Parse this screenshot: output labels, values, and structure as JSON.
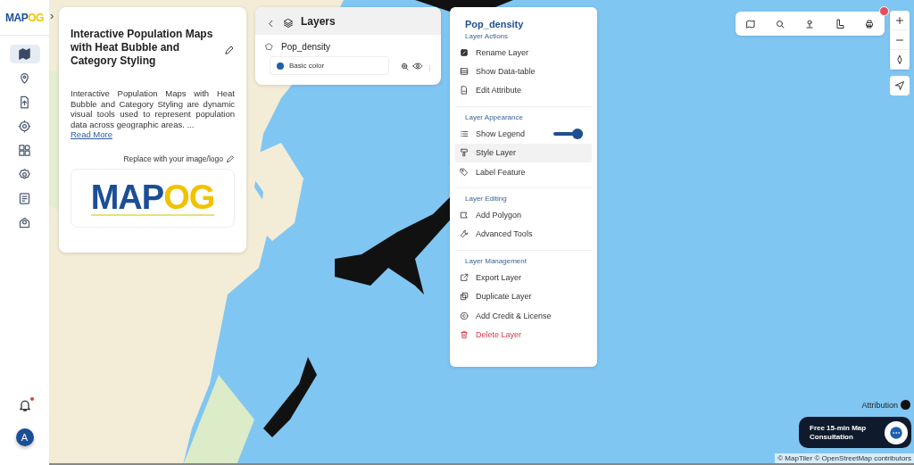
{
  "sidebar": {
    "logo": "MAPOG",
    "expand_glyph": "›",
    "nav_items": [
      {
        "kind": "map",
        "selected": true
      },
      {
        "kind": "pin",
        "selected": false
      },
      {
        "kind": "upload",
        "selected": false
      },
      {
        "kind": "gear",
        "selected": false
      },
      {
        "kind": "widgets",
        "selected": false
      },
      {
        "kind": "cog",
        "selected": false
      },
      {
        "kind": "report",
        "selected": false
      },
      {
        "kind": "share",
        "selected": false
      }
    ],
    "notifications_unread": true,
    "avatar": "A"
  },
  "info_card": {
    "title": "Interactive Population Maps with Heat Bubble and Category Styling",
    "description": "Interactive Population Maps with Heat Bubble and Category Styling are dynamic visual tools used to represent population data across geographic areas. ...",
    "read_more": "Read More",
    "replace_label": "Replace with your image/logo",
    "logo_text": "MAPOG"
  },
  "layers_panel": {
    "title": "Layers",
    "layer_name": "Pop_density",
    "style_label": "Basic color",
    "color": "#1f5fae"
  },
  "layer_menu": {
    "title": "Pop_density",
    "sections": [
      {
        "heading": "Layer Actions",
        "items": [
          {
            "kind": "rename",
            "label": "Rename Layer",
            "selected": false
          },
          {
            "kind": "table",
            "label": "Show Data-table",
            "selected": false
          },
          {
            "kind": "edit",
            "label": "Edit Attribute",
            "selected": false
          }
        ]
      },
      {
        "heading": "Layer Appearance",
        "items": [
          {
            "kind": "legend",
            "label": "Show Legend",
            "selected": false,
            "switch_on": true
          },
          {
            "kind": "style",
            "label": "Style Layer",
            "selected": true
          },
          {
            "kind": "label",
            "label": "Label Feature",
            "selected": false
          }
        ]
      },
      {
        "heading": "Layer Editing",
        "items": [
          {
            "kind": "polygon",
            "label": "Add Polygon",
            "selected": false
          },
          {
            "kind": "tools",
            "label": "Advanced Tools",
            "selected": false
          }
        ]
      },
      {
        "heading": "Layer Management",
        "items": [
          {
            "kind": "export",
            "label": "Export Layer",
            "selected": false
          },
          {
            "kind": "duplicate",
            "label": "Duplicate Layer",
            "selected": false
          },
          {
            "kind": "credit",
            "label": "Add Credit & License",
            "selected": false
          },
          {
            "kind": "delete",
            "label": "Delete Layer",
            "selected": false
          }
        ]
      }
    ]
  },
  "toolbar_badge": true,
  "attribution": "Attribution",
  "consultation": "Free 15-min Map Consultation",
  "copyright": "© MapTiler © OpenStreetMap contributors"
}
